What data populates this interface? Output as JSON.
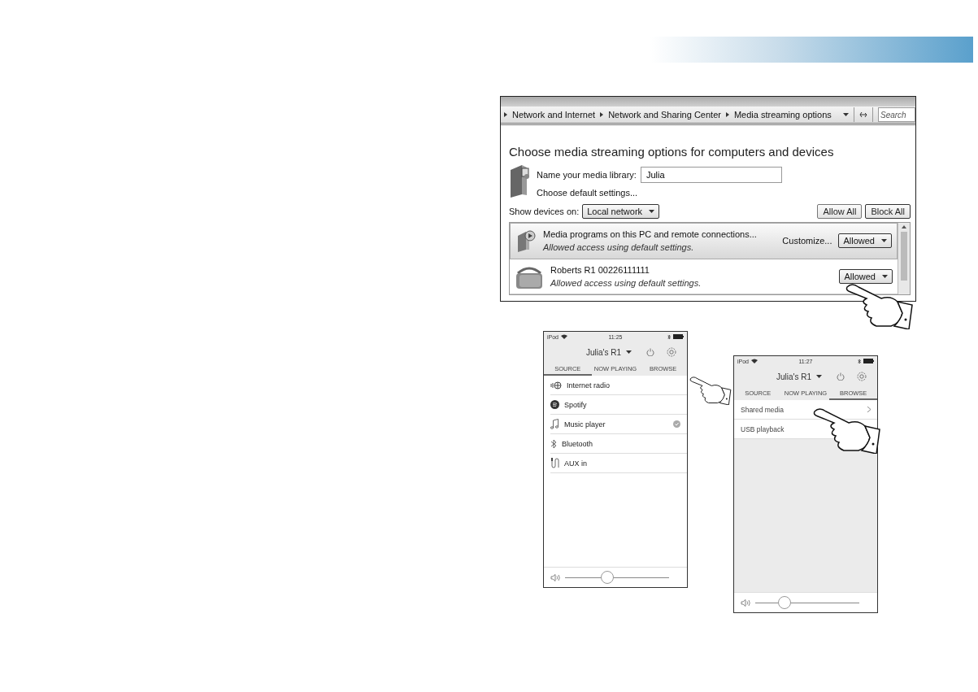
{
  "explorer": {
    "breadcrumbs": [
      "Network and Internet",
      "Network and Sharing Center",
      "Media streaming options"
    ],
    "search": {
      "placeholder": "Search"
    },
    "heading": "Choose media streaming options for computers and devices",
    "library_label": "Name your media library:",
    "library_name": "Julia",
    "defaults_link": "Choose default settings...",
    "show_devices_label": "Show devices on:",
    "show_devices_value": "Local network",
    "buttons": [
      "Allow All",
      "Block All"
    ],
    "devices": [
      {
        "kind": "computer",
        "name": "Media programs on this PC and remote connections...",
        "status": "Allowed access using default settings.",
        "customize": "Customize...",
        "access": "Allowed",
        "selected": true
      },
      {
        "kind": "radio",
        "name": "Roberts R1 00226111111",
        "status": "Allowed access using default settings.",
        "access": "Allowed",
        "selected": false
      }
    ]
  },
  "phones": [
    {
      "carrier": "iPod",
      "time": "11:25",
      "device": "Julia's R1",
      "tabs": [
        {
          "label": "SOURCE",
          "selected": true
        },
        {
          "label": "NOW PLAYING",
          "selected": false
        },
        {
          "label": "BROWSE",
          "selected": false
        }
      ],
      "items": [
        {
          "kind": "internet",
          "label": "Internet radio",
          "active": false
        },
        {
          "kind": "spotify",
          "label": "Spotify",
          "active": false
        },
        {
          "kind": "music",
          "label": "Music player",
          "active": true
        },
        {
          "kind": "bluetooth",
          "label": "Bluetooth",
          "active": false
        },
        {
          "kind": "aux",
          "label": "AUX in",
          "active": false
        }
      ],
      "volume": {
        "level": 0.41
      }
    },
    {
      "carrier": "iPod",
      "time": "11:27",
      "device": "Julia's R1",
      "tabs": [
        {
          "label": "SOURCE",
          "selected": false
        },
        {
          "label": "NOW PLAYING",
          "selected": false
        },
        {
          "label": "BROWSE",
          "selected": true
        }
      ],
      "items": [
        {
          "kind": "link",
          "label": "Shared media"
        },
        {
          "kind": "link",
          "label": "USB playback"
        }
      ],
      "volume": {
        "level": 0.28
      }
    }
  ]
}
